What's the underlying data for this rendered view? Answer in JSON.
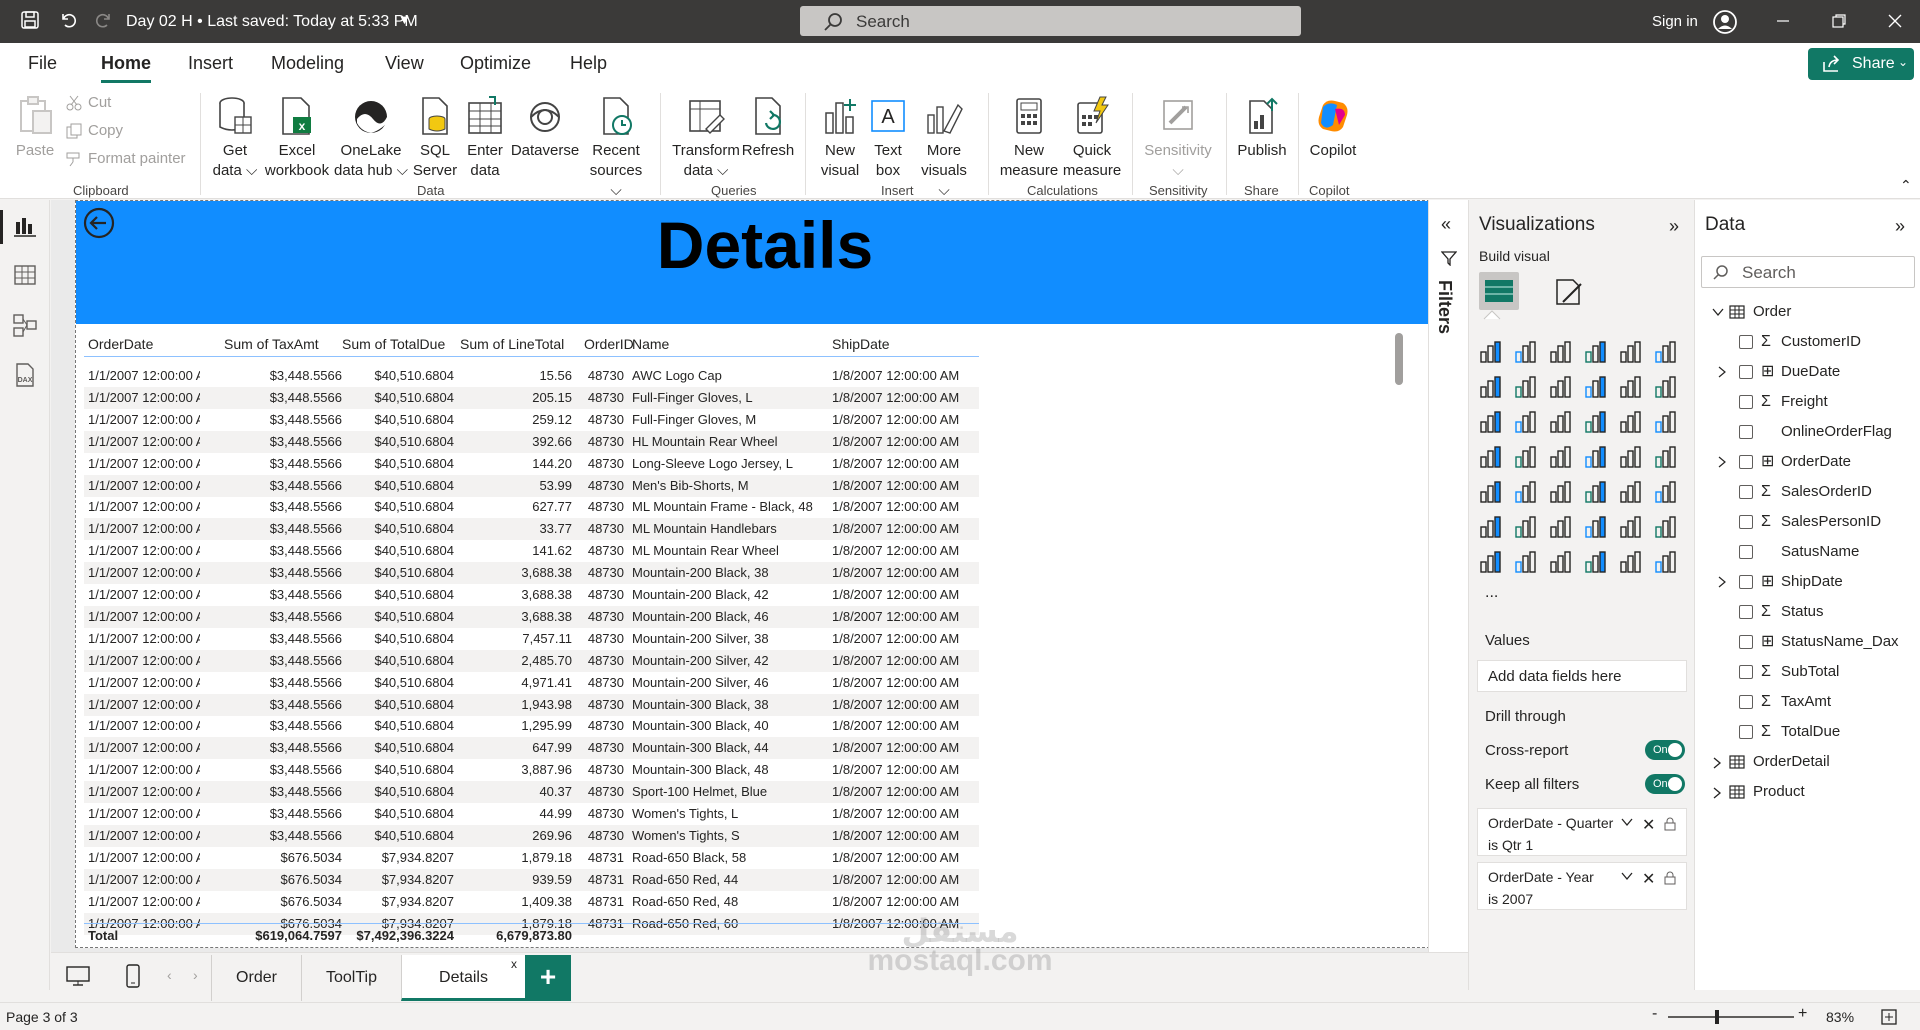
{
  "titlebar": {
    "title": "Day 02 H • Last saved: Today at 5:33 PM",
    "search_placeholder": "Search",
    "signin": "Sign in"
  },
  "ribbon_tabs": [
    "File",
    "Home",
    "Insert",
    "Modeling",
    "View",
    "Optimize",
    "Help"
  ],
  "share_label": "Share",
  "ribbon": {
    "paste": "Paste",
    "cut": "Cut",
    "copy": "Copy",
    "format_painter": "Format painter",
    "get_data": [
      "Get",
      "data ⌵"
    ],
    "excel": [
      "Excel",
      "workbook"
    ],
    "onelake": [
      "OneLake",
      "data hub ⌵"
    ],
    "sql": [
      "SQL",
      "Server"
    ],
    "enter_data": [
      "Enter",
      "data"
    ],
    "dataverse": [
      "Dataverse",
      ""
    ],
    "recent": [
      "Recent",
      "sources ⌵"
    ],
    "transform": [
      "Transform",
      "data ⌵"
    ],
    "refresh": [
      "Refresh",
      ""
    ],
    "new_visual": [
      "New",
      "visual"
    ],
    "text_box": [
      "Text",
      "box"
    ],
    "more_visuals": [
      "More",
      "visuals ⌵"
    ],
    "new_measure": [
      "New",
      "measure"
    ],
    "quick_measure": [
      "Quick",
      "measure"
    ],
    "sensitivity": [
      "Sensitivity",
      "⌵"
    ],
    "publish": [
      "Publish",
      ""
    ],
    "copilot": [
      "Copilot",
      ""
    ],
    "groups": [
      "Clipboard",
      "Data",
      "Queries",
      "Insert",
      "Calculations",
      "Sensitivity",
      "Share",
      "Copilot"
    ]
  },
  "report": {
    "title": "Details",
    "columns": [
      "OrderDate",
      "Sum of TaxAmt",
      "Sum of TotalDue",
      "Sum of LineTotal",
      "OrderID",
      "Name",
      "ShipDate"
    ],
    "rows": [
      [
        "1/1/2007 12:00:00 AM",
        "$3,448.5566",
        "$40,510.6804",
        "15.56",
        "48730",
        "AWC Logo Cap",
        "1/8/2007 12:00:00 AM"
      ],
      [
        "1/1/2007 12:00:00 AM",
        "$3,448.5566",
        "$40,510.6804",
        "205.15",
        "48730",
        "Full-Finger Gloves, L",
        "1/8/2007 12:00:00 AM"
      ],
      [
        "1/1/2007 12:00:00 AM",
        "$3,448.5566",
        "$40,510.6804",
        "259.12",
        "48730",
        "Full-Finger Gloves, M",
        "1/8/2007 12:00:00 AM"
      ],
      [
        "1/1/2007 12:00:00 AM",
        "$3,448.5566",
        "$40,510.6804",
        "392.66",
        "48730",
        "HL Mountain Rear Wheel",
        "1/8/2007 12:00:00 AM"
      ],
      [
        "1/1/2007 12:00:00 AM",
        "$3,448.5566",
        "$40,510.6804",
        "144.20",
        "48730",
        "Long-Sleeve Logo Jersey, L",
        "1/8/2007 12:00:00 AM"
      ],
      [
        "1/1/2007 12:00:00 AM",
        "$3,448.5566",
        "$40,510.6804",
        "53.99",
        "48730",
        "Men's Bib-Shorts, M",
        "1/8/2007 12:00:00 AM"
      ],
      [
        "1/1/2007 12:00:00 AM",
        "$3,448.5566",
        "$40,510.6804",
        "627.77",
        "48730",
        "ML Mountain Frame - Black, 48",
        "1/8/2007 12:00:00 AM"
      ],
      [
        "1/1/2007 12:00:00 AM",
        "$3,448.5566",
        "$40,510.6804",
        "33.77",
        "48730",
        "ML Mountain Handlebars",
        "1/8/2007 12:00:00 AM"
      ],
      [
        "1/1/2007 12:00:00 AM",
        "$3,448.5566",
        "$40,510.6804",
        "141.62",
        "48730",
        "ML Mountain Rear Wheel",
        "1/8/2007 12:00:00 AM"
      ],
      [
        "1/1/2007 12:00:00 AM",
        "$3,448.5566",
        "$40,510.6804",
        "3,688.38",
        "48730",
        "Mountain-200 Black, 38",
        "1/8/2007 12:00:00 AM"
      ],
      [
        "1/1/2007 12:00:00 AM",
        "$3,448.5566",
        "$40,510.6804",
        "3,688.38",
        "48730",
        "Mountain-200 Black, 42",
        "1/8/2007 12:00:00 AM"
      ],
      [
        "1/1/2007 12:00:00 AM",
        "$3,448.5566",
        "$40,510.6804",
        "3,688.38",
        "48730",
        "Mountain-200 Black, 46",
        "1/8/2007 12:00:00 AM"
      ],
      [
        "1/1/2007 12:00:00 AM",
        "$3,448.5566",
        "$40,510.6804",
        "7,457.11",
        "48730",
        "Mountain-200 Silver, 38",
        "1/8/2007 12:00:00 AM"
      ],
      [
        "1/1/2007 12:00:00 AM",
        "$3,448.5566",
        "$40,510.6804",
        "2,485.70",
        "48730",
        "Mountain-200 Silver, 42",
        "1/8/2007 12:00:00 AM"
      ],
      [
        "1/1/2007 12:00:00 AM",
        "$3,448.5566",
        "$40,510.6804",
        "4,971.41",
        "48730",
        "Mountain-200 Silver, 46",
        "1/8/2007 12:00:00 AM"
      ],
      [
        "1/1/2007 12:00:00 AM",
        "$3,448.5566",
        "$40,510.6804",
        "1,943.98",
        "48730",
        "Mountain-300 Black, 38",
        "1/8/2007 12:00:00 AM"
      ],
      [
        "1/1/2007 12:00:00 AM",
        "$3,448.5566",
        "$40,510.6804",
        "1,295.99",
        "48730",
        "Mountain-300 Black, 40",
        "1/8/2007 12:00:00 AM"
      ],
      [
        "1/1/2007 12:00:00 AM",
        "$3,448.5566",
        "$40,510.6804",
        "647.99",
        "48730",
        "Mountain-300 Black, 44",
        "1/8/2007 12:00:00 AM"
      ],
      [
        "1/1/2007 12:00:00 AM",
        "$3,448.5566",
        "$40,510.6804",
        "3,887.96",
        "48730",
        "Mountain-300 Black, 48",
        "1/8/2007 12:00:00 AM"
      ],
      [
        "1/1/2007 12:00:00 AM",
        "$3,448.5566",
        "$40,510.6804",
        "40.37",
        "48730",
        "Sport-100 Helmet, Blue",
        "1/8/2007 12:00:00 AM"
      ],
      [
        "1/1/2007 12:00:00 AM",
        "$3,448.5566",
        "$40,510.6804",
        "44.99",
        "48730",
        "Women's Tights, L",
        "1/8/2007 12:00:00 AM"
      ],
      [
        "1/1/2007 12:00:00 AM",
        "$3,448.5566",
        "$40,510.6804",
        "269.96",
        "48730",
        "Women's Tights, S",
        "1/8/2007 12:00:00 AM"
      ],
      [
        "1/1/2007 12:00:00 AM",
        "$676.5034",
        "$7,934.8207",
        "1,879.18",
        "48731",
        "Road-650 Black, 58",
        "1/8/2007 12:00:00 AM"
      ],
      [
        "1/1/2007 12:00:00 AM",
        "$676.5034",
        "$7,934.8207",
        "939.59",
        "48731",
        "Road-650 Red, 44",
        "1/8/2007 12:00:00 AM"
      ],
      [
        "1/1/2007 12:00:00 AM",
        "$676.5034",
        "$7,934.8207",
        "1,409.38",
        "48731",
        "Road-650 Red, 48",
        "1/8/2007 12:00:00 AM"
      ],
      [
        "1/1/2007 12:00:00 AM",
        "$676.5034",
        "$7,934.8207",
        "1,879.18",
        "48731",
        "Road-650 Red, 60",
        "1/8/2007 12:00:00 AM"
      ]
    ],
    "totals": [
      "Total",
      "$619,064.7597",
      "$7,492,396.3224",
      "6,679,873.80",
      "",
      "",
      ""
    ]
  },
  "filters_label": "Filters",
  "visualizations": {
    "title": "Visualizations",
    "build_visual": "Build visual",
    "values_label": "Values",
    "values_placeholder": "Add data fields here",
    "drill_through": "Drill through",
    "cross_report": "Cross-report",
    "keep_all_filters": "Keep all filters",
    "toggle_on": "On",
    "more": "...",
    "filter_cards": [
      {
        "field": "OrderDate - Quarter",
        "condition": "is Qtr 1"
      },
      {
        "field": "OrderDate - Year",
        "condition": "is 2007"
      }
    ]
  },
  "data_pane": {
    "title": "Data",
    "search_placeholder": "Search",
    "tables": {
      "order": "Order",
      "order_detail": "OrderDetail",
      "product": "Product"
    },
    "fields": [
      {
        "name": "CustomerID",
        "sigma": "Σ",
        "expand": ""
      },
      {
        "name": "DueDate",
        "sigma": "⊞",
        "expand": "›"
      },
      {
        "name": "Freight",
        "sigma": "Σ",
        "expand": ""
      },
      {
        "name": "OnlineOrderFlag",
        "sigma": "",
        "expand": ""
      },
      {
        "name": "OrderDate",
        "sigma": "⊞",
        "expand": "›"
      },
      {
        "name": "SalesOrderID",
        "sigma": "Σ",
        "expand": ""
      },
      {
        "name": "SalesPersonID",
        "sigma": "Σ",
        "expand": ""
      },
      {
        "name": "SatusName",
        "sigma": "",
        "expand": ""
      },
      {
        "name": "ShipDate",
        "sigma": "⊞",
        "expand": "›"
      },
      {
        "name": "Status",
        "sigma": "Σ",
        "expand": ""
      },
      {
        "name": "StatusName_Dax",
        "sigma": "⊞",
        "expand": ""
      },
      {
        "name": "SubTotal",
        "sigma": "Σ",
        "expand": ""
      },
      {
        "name": "TaxAmt",
        "sigma": "Σ",
        "expand": ""
      },
      {
        "name": "TotalDue",
        "sigma": "Σ",
        "expand": ""
      }
    ]
  },
  "page_tabs": [
    "Order",
    "ToolTip",
    "Details"
  ],
  "page_tab_close": "x",
  "add_page": "+",
  "status": {
    "page": "Page 3 of 3",
    "zoom_minus": "-",
    "zoom_plus": "+",
    "zoom": "83%"
  },
  "watermark": [
    "مستقل",
    "mostaql.com"
  ],
  "colors": {
    "accent": "#117865",
    "banner": "#118dff",
    "titlebar": "#3b3a39"
  }
}
